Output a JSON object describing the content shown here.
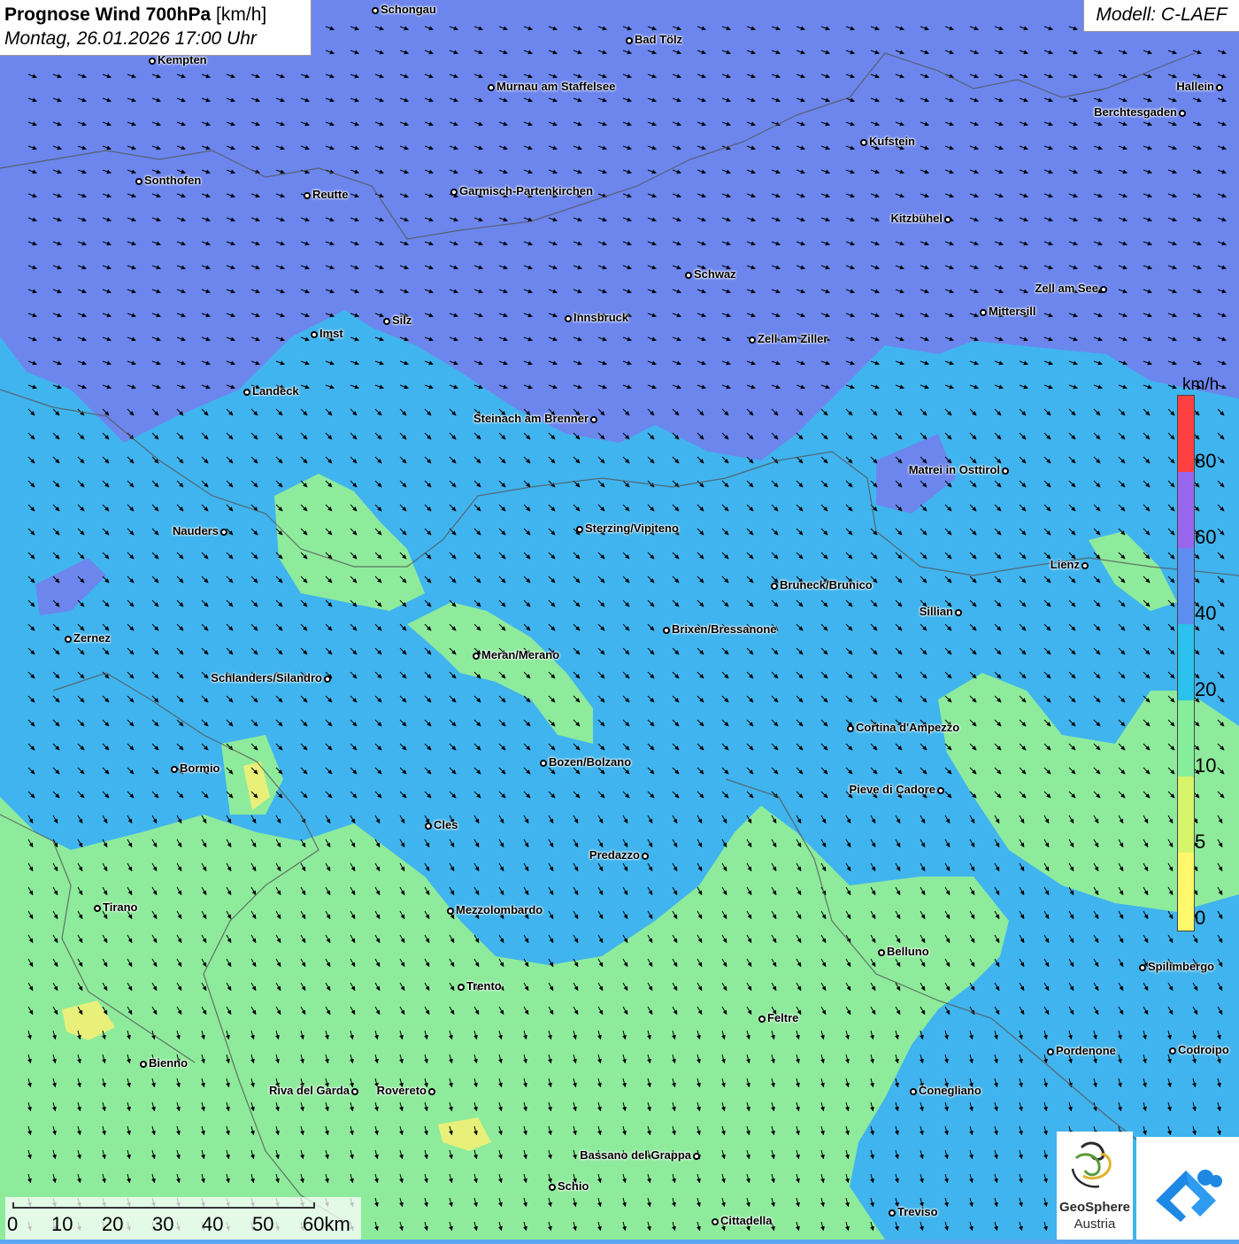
{
  "header": {
    "title_bold": "Prognose Wind 700hPa",
    "title_unit": "[km/h]",
    "date": "Montag, 26.01.2026 17:00 Uhr",
    "model": "Modell: C-LAEF"
  },
  "legend": {
    "unit": "km/h",
    "ticks": [
      "80",
      "60",
      "40",
      "20",
      "10",
      "5",
      "0"
    ],
    "colors": [
      "#ff4040",
      "#9966ee",
      "#5c8ef0",
      "#2cc2ee",
      "#86ee9a",
      "#d6f46a",
      "#fff86a"
    ]
  },
  "scale": {
    "labels": [
      "0",
      "10",
      "20",
      "30",
      "40",
      "50",
      "60km"
    ]
  },
  "logos": {
    "geosphere_line1": "GeoSphere",
    "geosphere_line2": "Austria"
  },
  "colors": {
    "strong_wind": "#6c86ee",
    "medium_wind": "#40b4ee",
    "light_wind": "#8eeb9c",
    "calm": "#e8f07a"
  },
  "cities": [
    {
      "name": "Schongau"
    },
    {
      "name": "Bad Tölz"
    },
    {
      "name": "Kempten"
    },
    {
      "name": "Murnau am Staffelsee"
    },
    {
      "name": "Hallein"
    },
    {
      "name": "Berchtesgaden"
    },
    {
      "name": "Kufstein"
    },
    {
      "name": "Sonthofen"
    },
    {
      "name": "Reutte"
    },
    {
      "name": "Garmisch-Partenkirchen"
    },
    {
      "name": "Kitzbühel"
    },
    {
      "name": "Schwaz"
    },
    {
      "name": "Zell am See"
    },
    {
      "name": "Mittersill"
    },
    {
      "name": "Silz"
    },
    {
      "name": "Innsbruck"
    },
    {
      "name": "Imst"
    },
    {
      "name": "Zell am Ziller"
    },
    {
      "name": "Landeck"
    },
    {
      "name": "Steinach am Brenner"
    },
    {
      "name": "Matrei in Osttirol"
    },
    {
      "name": "Nauders"
    },
    {
      "name": "Sterzing/Vipiteno"
    },
    {
      "name": "Lienz"
    },
    {
      "name": "Bruneck/Brunico"
    },
    {
      "name": "Sillian"
    },
    {
      "name": "Brixen/Bressanone"
    },
    {
      "name": "Zernez"
    },
    {
      "name": "Meran/Merano"
    },
    {
      "name": "Schlanders/Silandro"
    },
    {
      "name": "Cortina d'Ampezzo"
    },
    {
      "name": "Bozen/Bolzano"
    },
    {
      "name": "Bormio"
    },
    {
      "name": "Pieve di Cadore"
    },
    {
      "name": "Cles"
    },
    {
      "name": "Predazzo"
    },
    {
      "name": "Tirano"
    },
    {
      "name": "Mezzolombardo"
    },
    {
      "name": "Belluno"
    },
    {
      "name": "Spilimbergo"
    },
    {
      "name": "Trento"
    },
    {
      "name": "Feltre"
    },
    {
      "name": "Bienno"
    },
    {
      "name": "Pordenone"
    },
    {
      "name": "Codroipo"
    },
    {
      "name": "Riva del Garda"
    },
    {
      "name": "Rovereto"
    },
    {
      "name": "Conegliano"
    },
    {
      "name": "Bassano del Grappa"
    },
    {
      "name": "Schio"
    },
    {
      "name": "Treviso"
    },
    {
      "name": "Cittadella"
    }
  ]
}
